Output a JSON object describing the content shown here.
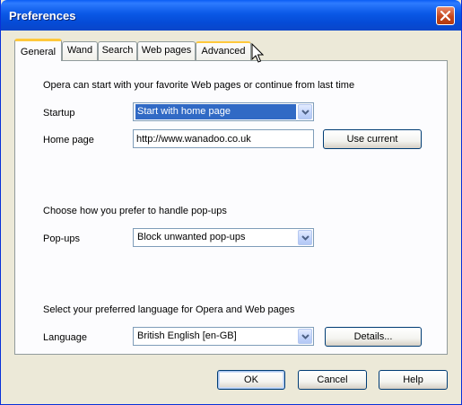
{
  "window": {
    "title": "Preferences"
  },
  "tabs": [
    {
      "label": "General",
      "active": true
    },
    {
      "label": "Wand"
    },
    {
      "label": "Search"
    },
    {
      "label": "Web pages"
    },
    {
      "label": "Advanced"
    }
  ],
  "startup_section": {
    "intro": "Opera can start with your favorite Web pages or continue from last time",
    "startup_label": "Startup",
    "startup_value": "Start with home page",
    "homepage_label": "Home page",
    "homepage_value": "http://www.wanadoo.co.uk",
    "use_current_label": "Use current"
  },
  "popup_section": {
    "intro": "Choose how you prefer to handle pop-ups",
    "popups_label": "Pop-ups",
    "popups_value": "Block unwanted pop-ups"
  },
  "language_section": {
    "intro": "Select your preferred language for Opera and Web pages",
    "language_label": "Language",
    "language_value": "British English [en-GB]",
    "details_label": "Details..."
  },
  "footer": {
    "ok_label": "OK",
    "cancel_label": "Cancel",
    "help_label": "Help"
  },
  "icons": [
    "close-icon",
    "chevron-down-icon",
    "mouse-cursor-icon"
  ],
  "colors": {
    "titlebar": "#0A58E6",
    "dialog_bg": "#ECE9D8",
    "selection": "#316AC5",
    "tab_highlight": "#FFC83C"
  }
}
